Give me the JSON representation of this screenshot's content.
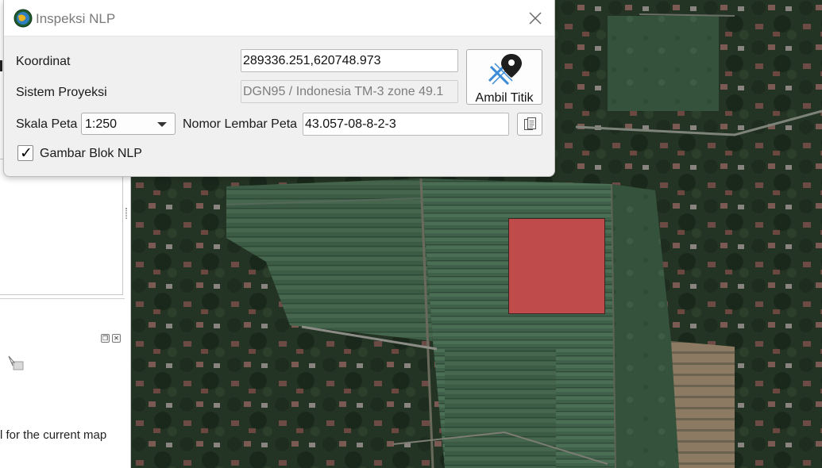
{
  "dialog": {
    "title": "Inspeksi NLP",
    "close_icon": "close-icon",
    "koordinat": {
      "label": "Koordinat",
      "value": "289336.251,620748.973"
    },
    "sistem_proyeksi": {
      "label": "Sistem Proyeksi",
      "value": "DGN95 / Indonesia TM-3 zone 49.1"
    },
    "ambil_titik": {
      "label": "Ambil Titik",
      "icon": "map-pin-icon"
    },
    "skala_peta": {
      "label": "Skala Peta",
      "value": "1:250"
    },
    "nomor_lembar_peta": {
      "label": "Nomor Lembar Peta",
      "value": "43.057-08-8-2-3"
    },
    "copy_icon": "clipboard-icon",
    "gambar_blok_nlp": {
      "label": "Gambar Blok NLP",
      "checked": true,
      "mark": "✓"
    }
  },
  "left_panel": {
    "dock_float_glyph": "❐",
    "dock_close_glyph": "✕",
    "tip_text": "l for the current map"
  },
  "map": {
    "nlp_block_color": "#c04b4b"
  }
}
